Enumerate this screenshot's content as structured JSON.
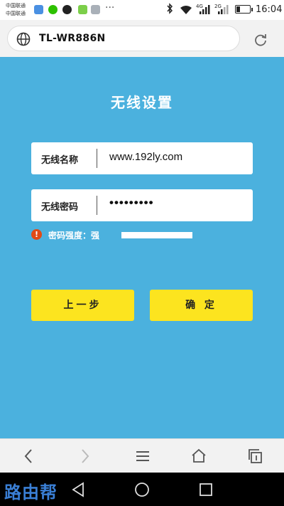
{
  "status_bar": {
    "carrier_1": "中国联通",
    "carrier_2": "中国联通",
    "more_notifications": "···",
    "network_1": "4G",
    "network_2": "2G",
    "time": "16:04"
  },
  "browser": {
    "url": "TL-WR886N"
  },
  "page": {
    "title": "无线设置",
    "ssid_label": "无线名称",
    "ssid_value": "www.192ly.com",
    "password_label": "无线密码",
    "password_value": "•••••••••",
    "strength_icon": "!",
    "strength_text": "密码强度：强",
    "strength_level": 1.0,
    "prev_button": "上一步",
    "confirm_button": "确 定"
  },
  "watermark": "路由帮",
  "colors": {
    "background": "#4bb1de",
    "button": "#fce41f",
    "warning": "#e14a14",
    "watermark": "#3a7fd5"
  }
}
